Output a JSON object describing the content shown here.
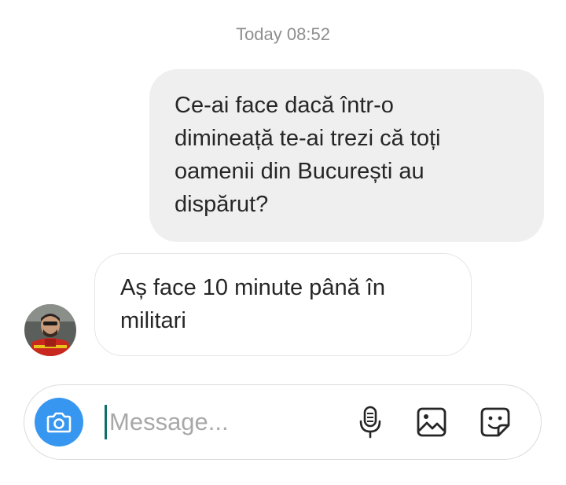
{
  "thread": {
    "timestamp": "Today 08:52",
    "messages": [
      {
        "direction": "outgoing",
        "lines": [
          "Ce-ai face dacă într-o",
          "dimineață te-ai trezi că toți",
          "oamenii din București au",
          "dispărut?"
        ]
      },
      {
        "direction": "incoming",
        "lines": [
          "Aș face 10 minute până în",
          "militari"
        ]
      }
    ]
  },
  "composer": {
    "value": "",
    "placeholder": "Message...",
    "left_icon": "camera-icon",
    "right_icons": [
      "microphone-icon",
      "gallery-icon",
      "sticker-icon"
    ]
  },
  "colors": {
    "accent": "#3797f0",
    "outgoing_bubble": "#efefef",
    "incoming_border": "#e6e6e6",
    "timestamp": "#8e8e8e",
    "caret": "#0e6f68"
  }
}
